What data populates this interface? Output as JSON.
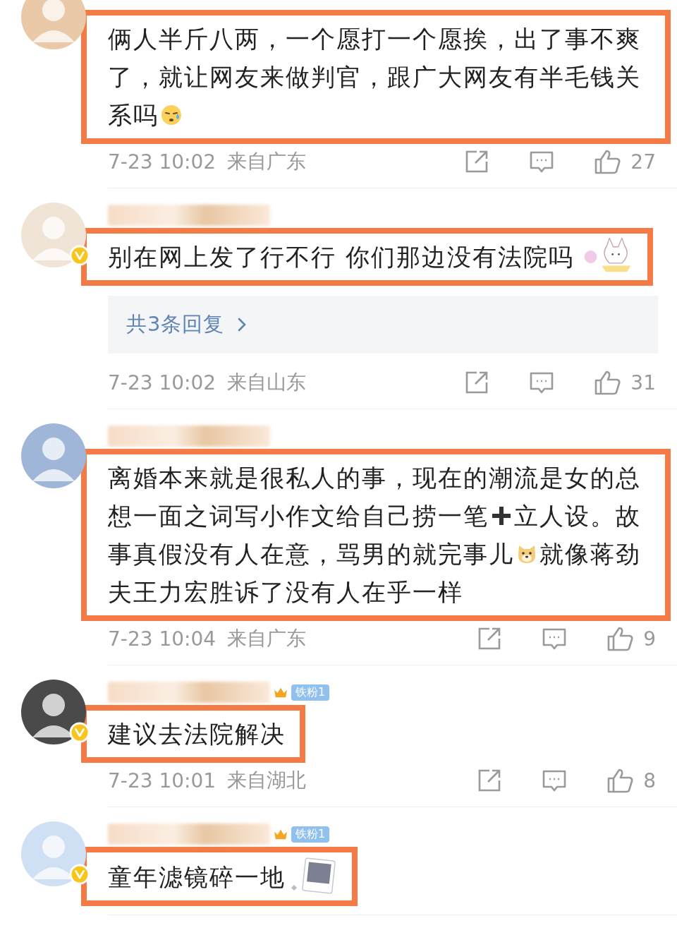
{
  "comments": [
    {
      "name_blurred": false,
      "verified": false,
      "highlighted": true,
      "segments": [
        {
          "kind": "text",
          "text": "俩人半斤八两，一个愿打一个愿挨，出了事不爽了，就让网友来做判官，跟广大网友有半毛钱关系吗"
        },
        {
          "kind": "sweat"
        }
      ],
      "date": "7-23 10:02",
      "location": "来自广东",
      "likes": "27"
    },
    {
      "name_blurred": true,
      "verified": true,
      "highlighted": true,
      "segments": [
        {
          "kind": "text",
          "text": "别在网上发了行不行 你们那边没有法院吗"
        }
      ],
      "sticker": {
        "kind": "bunny"
      },
      "replies": "共3条回复",
      "date": "7-23 10:02",
      "location": "来自山东",
      "likes": "31"
    },
    {
      "name_blurred": true,
      "verified": false,
      "highlighted": true,
      "segments": [
        {
          "kind": "text",
          "text": "离婚本来就是很私人的事，现在的潮流是女的总想一面之词写小作文给自己捞一笔"
        },
        {
          "kind": "plus"
        },
        {
          "kind": "text",
          "text": "立人设。故事真假没有人在意，骂男的就完事儿"
        },
        {
          "kind": "dog"
        },
        {
          "kind": "text",
          "text": "就像蒋劲夫王力宏胜诉了没有人在乎一样"
        }
      ],
      "date": "7-23 10:04",
      "location": "来自广东",
      "likes": "9"
    },
    {
      "name_blurred": true,
      "fan_badge": "铁粉1",
      "verified": true,
      "highlighted": true,
      "segments": [
        {
          "kind": "text",
          "text": "建议去法院解决"
        }
      ],
      "date": "7-23 10:01",
      "location": "来自湖北",
      "likes": "8"
    },
    {
      "name_blurred": true,
      "fan_badge": "铁粉1",
      "verified": true,
      "highlighted": true,
      "segments": [
        {
          "kind": "text",
          "text": "童年滤镜碎一地"
        }
      ],
      "sticker": {
        "kind": "photo"
      }
    }
  ]
}
